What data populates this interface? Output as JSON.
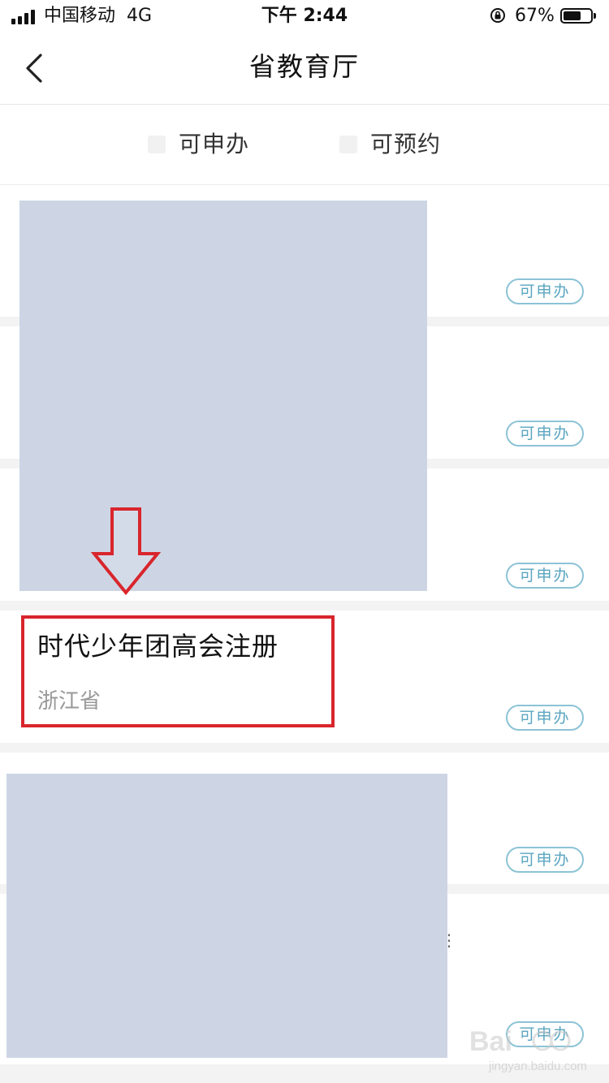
{
  "status_bar": {
    "carrier": "中国移动",
    "network": "4G",
    "time": "下午 2:44",
    "battery": "67%",
    "battery_level": 0.67
  },
  "nav": {
    "title": "省教育厅",
    "back_icon": "chevron-left-icon"
  },
  "filters": [
    {
      "label": "可申办",
      "checked": false
    },
    {
      "label": "可预约",
      "checked": false
    }
  ],
  "items": [
    {
      "title": "",
      "region": "",
      "badge": "可申办",
      "redacted": true
    },
    {
      "title": "",
      "region": "",
      "badge": "可申办",
      "redacted": true
    },
    {
      "title": "",
      "region": "",
      "badge": "可申办",
      "redacted": true
    },
    {
      "title": "时代少年团高会注册",
      "region": "浙江省",
      "badge": "可申办",
      "redacted": false
    },
    {
      "title": "",
      "region": "",
      "badge": "可申办",
      "redacted": true
    },
    {
      "title": "",
      "region": "",
      "badge": "可申办",
      "redacted": true
    }
  ],
  "annotation": {
    "color": "#d9252c",
    "arrow_icon": "down-arrow-icon"
  },
  "colors": {
    "badge_border": "#8cc3d6",
    "badge_text": "#5aa5c0",
    "mask": "#cdd5e4"
  },
  "watermark": {
    "brand": "Bai",
    "url": "jingyan.baidu.com"
  }
}
